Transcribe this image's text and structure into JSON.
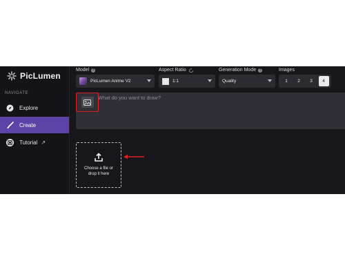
{
  "app": {
    "name": "PicLumen"
  },
  "sidebar": {
    "section_header": "NAVIGATE",
    "items": [
      {
        "label": "Explore",
        "icon": "compass-icon"
      },
      {
        "label": "Create",
        "icon": "brush-icon",
        "active": true
      },
      {
        "label": "Tutorial",
        "icon": "lifebuoy-icon",
        "external_icon": "↗"
      }
    ]
  },
  "controls": {
    "model": {
      "label": "Model",
      "value": "PicLumen Anime V2"
    },
    "aspect_ratio": {
      "label": "Aspect Ratio",
      "value": "1:1"
    },
    "generation_mode": {
      "label": "Generation Mode",
      "value": "Quality"
    },
    "images": {
      "label": "Images",
      "options": [
        "1",
        "2",
        "3",
        "4"
      ],
      "selected": "4"
    }
  },
  "prompt": {
    "placeholder": "What do you want to draw?"
  },
  "dropzone": {
    "line1": "Choose a file or",
    "line2": "drop it here"
  },
  "colors": {
    "accent": "#5b43a8",
    "highlight": "#e02020"
  }
}
